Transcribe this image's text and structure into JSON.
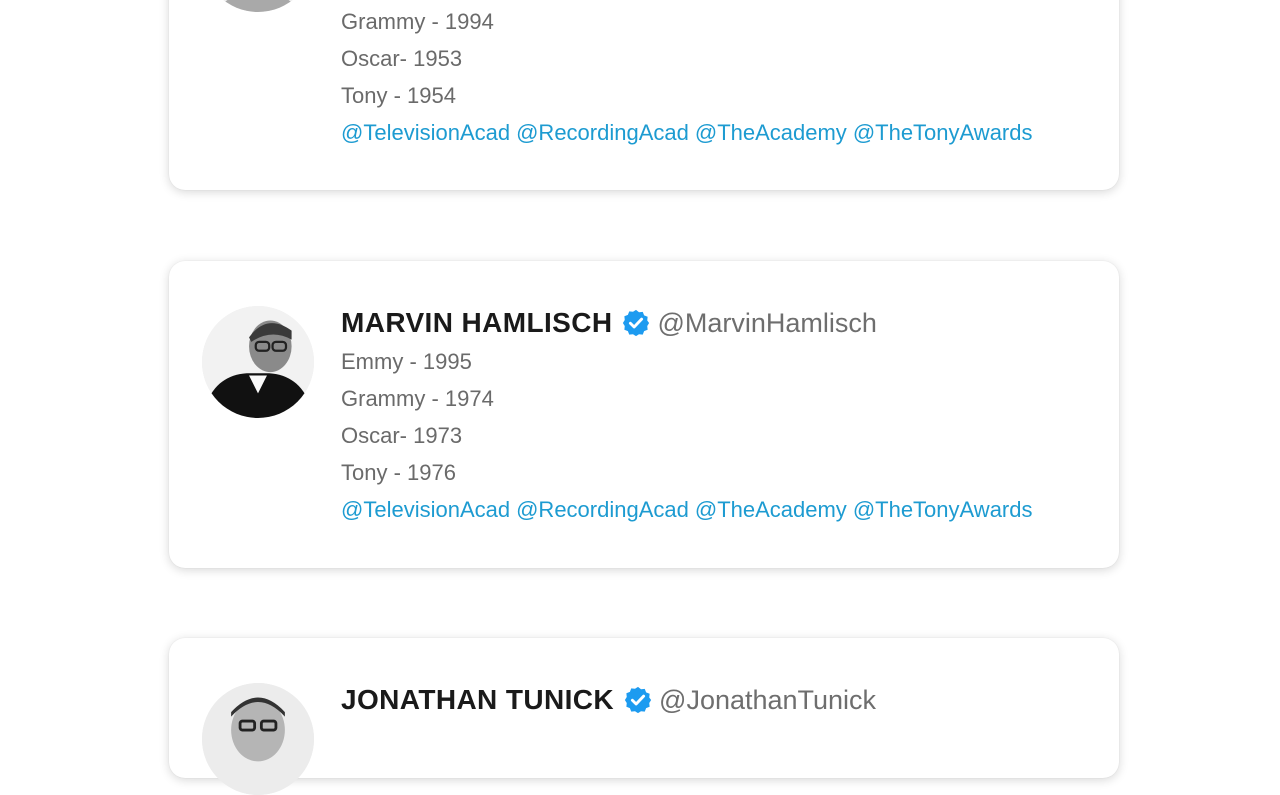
{
  "colors": {
    "link": "#1d9bd1",
    "verified": "#1d9bf0",
    "text": "#1a1a1a",
    "muted": "#6a6a6a"
  },
  "cards": [
    {
      "name": "",
      "handle": "",
      "awards": [
        "Grammy - 1994",
        "Oscar- 1953",
        "Tony - 1954"
      ],
      "tags": [
        "@TelevisionAcad",
        "@RecordingAcad",
        "@TheAcademy",
        "@TheTonyAwards"
      ]
    },
    {
      "name": "MARVIN HAMLISCH",
      "handle": "@MarvinHamlisch",
      "awards": [
        "Emmy - 1995",
        "Grammy - 1974",
        "Oscar- 1973",
        "Tony - 1976"
      ],
      "tags": [
        "@TelevisionAcad",
        "@RecordingAcad",
        "@TheAcademy",
        "@TheTonyAwards"
      ]
    },
    {
      "name": "JONATHAN TUNICK",
      "handle": "@JonathanTunick",
      "awards": [],
      "tags": []
    }
  ]
}
